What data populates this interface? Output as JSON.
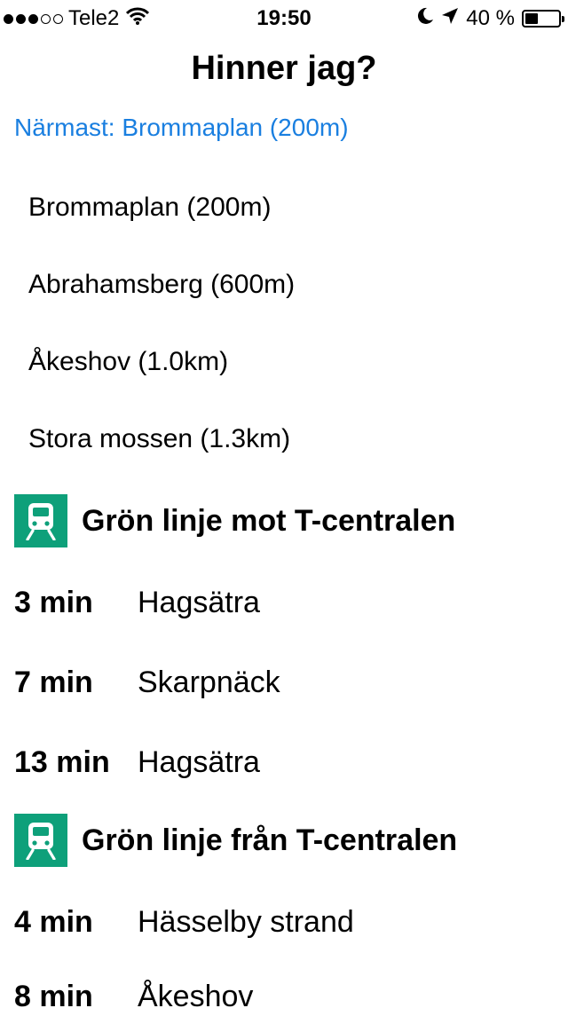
{
  "status_bar": {
    "carrier": "Tele2",
    "time": "19:50",
    "battery_text": "40 %",
    "battery_level": 0.4,
    "signal_bars_filled": 3,
    "signal_bars_total": 5
  },
  "title": "Hinner jag?",
  "nearest": "Närmast: Brommaplan (200m)",
  "stations": [
    {
      "label": "Brommaplan (200m)"
    },
    {
      "label": "Abrahamsberg (600m)"
    },
    {
      "label": "Åkeshov (1.0km)"
    },
    {
      "label": "Stora mossen (1.3km)"
    }
  ],
  "lines": [
    {
      "title": "Grön linje mot T-centralen",
      "icon": "metro-train-icon",
      "departures": [
        {
          "time": "3 min",
          "destination": "Hagsätra"
        },
        {
          "time": "7 min",
          "destination": "Skarpnäck"
        },
        {
          "time": "13 min",
          "destination": "Hagsätra"
        }
      ]
    },
    {
      "title": "Grön linje från T-centralen",
      "icon": "metro-train-icon",
      "departures": [
        {
          "time": "4 min",
          "destination": "Hässelby strand"
        },
        {
          "time": "8 min",
          "destination": "Åkeshov"
        }
      ]
    }
  ],
  "colors": {
    "accent": "#1a7fe0",
    "metro_green": "#0ea07a"
  }
}
